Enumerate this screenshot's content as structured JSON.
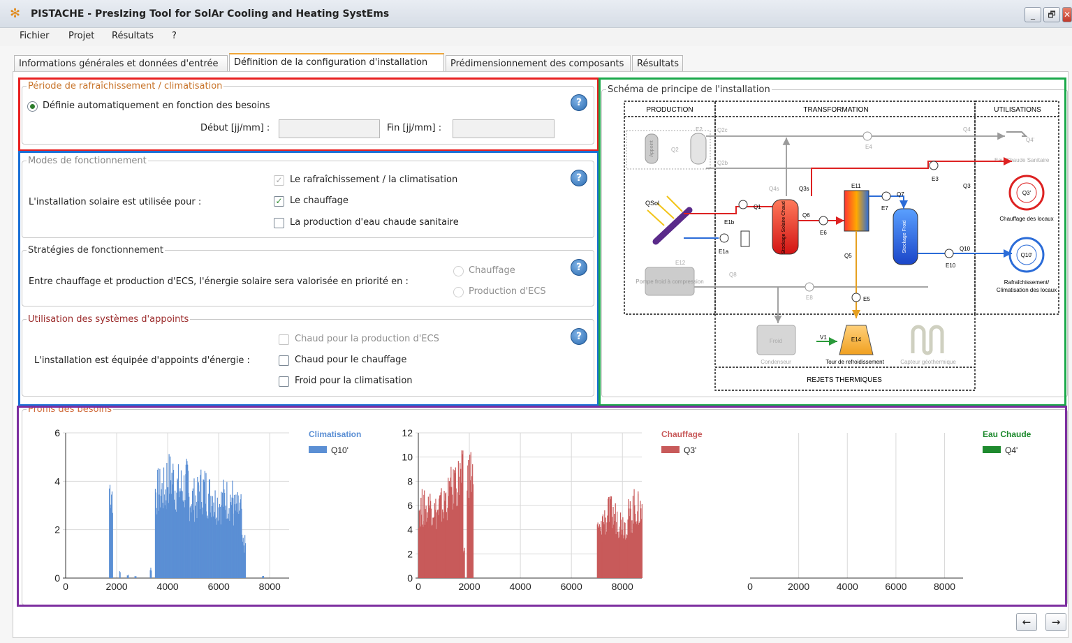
{
  "window": {
    "title": "PISTACHE - PresIzing Tool for SolAr Cooling and Heating SystEms",
    "minimize": "_",
    "restore": "🗗",
    "close": "✕"
  },
  "menu": [
    "Fichier",
    "Projet",
    "Résultats",
    "?"
  ],
  "tabs": [
    "Informations générales et données d'entrée",
    "Définition de la configuration d'installation",
    "Prédimensionnement des composants",
    "Résultats"
  ],
  "periode": {
    "legend": "Période de rafraîchissement / climatisation",
    "radio_label": "Définie automatiquement en fonction des besoins",
    "debut_label": "Début [jj/mm] :",
    "fin_label": "Fin [jj/mm] :",
    "debut_value": "",
    "fin_value": "",
    "help": "?"
  },
  "modes": {
    "legend": "Modes de fonctionnement",
    "question": "L'installation solaire est utilisée pour :",
    "options": [
      "Le rafraîchissement / la climatisation",
      "Le chauffage",
      "La production d'eau chaude sanitaire"
    ],
    "help": "?"
  },
  "strategies": {
    "legend": "Stratégies de fonctionnement",
    "question": "Entre chauffage et production d'ECS, l'énergie solaire sera valorisée en priorité en :",
    "options": [
      "Chauffage",
      "Production d'ECS"
    ],
    "help": "?"
  },
  "appoints": {
    "legend": "Utilisation des systèmes d'appoints",
    "question": "L'installation est équipée d'appoints d'énergie :",
    "options": [
      "Chaud pour la production d'ECS",
      "Chaud pour le chauffage",
      "Froid pour la climatisation"
    ],
    "help": "?"
  },
  "schema": {
    "legend": "Schéma de principe de l'installation",
    "production": "PRODUCTION",
    "transformation": "TRANSFORMATION",
    "utilisations": "UTILISATIONS",
    "rejets": "REJETS THERMIQUES",
    "labels": {
      "qsol": "QSol",
      "appoint": "Appoint",
      "q2": "Q2",
      "q2b": "Q2b",
      "q2c": "Q2c",
      "e2": "E2",
      "e4": "E4",
      "q4": "Q4",
      "q4p": "Q4'",
      "ecs": "Eau Chaude Sanitaire",
      "e3": "E3",
      "q3": "Q3",
      "q3s": "Q3s",
      "q4s": "Q4s",
      "e11": "E11",
      "q7": "Q7",
      "e7": "E7",
      "q1": "Q1",
      "e1b": "E1b",
      "e1a": "E1a",
      "q6": "Q6",
      "e6": "E6",
      "stock_chaud": "Stockage Solaire Chaud",
      "stock_froid": "Stockage Froid",
      "q5": "Q5",
      "e5": "E5",
      "q3p": "Q3'",
      "chauffage": "Chauffage des locaux",
      "q10": "Q10",
      "e10": "E10",
      "q10p": "Q10'",
      "rafr1": "Rafraîchissement/",
      "rafr2": "Climatisation des locaux",
      "e12": "E12",
      "pac": "Pompe froid à compression",
      "q8": "Q8",
      "e8": "E8",
      "v1": "V1",
      "e14": "E14",
      "condenseur": "Condenseur",
      "tour": "Tour de refroidissement",
      "geo": "Capteur géothermique",
      "cond_box": "Froid"
    }
  },
  "profils": {
    "legend": "Profils des besoins"
  },
  "chart_data": [
    {
      "type": "bar",
      "title": "Climatisation",
      "series": [
        {
          "name": "Q10'",
          "color": "#5b8fd4"
        }
      ],
      "xlim": [
        0,
        8760
      ],
      "ylim": [
        0,
        6
      ],
      "xticks": [
        0,
        2000,
        4000,
        6000,
        8000
      ],
      "yticks": [
        0,
        2,
        4,
        6
      ],
      "values_ranges": [
        [
          1700,
          1760,
          4.8
        ],
        [
          1760,
          1830,
          4.6
        ],
        [
          2100,
          2140,
          0.3
        ],
        [
          2400,
          2450,
          0.15
        ],
        [
          2700,
          2750,
          0.1
        ],
        [
          3300,
          3350,
          0.5
        ],
        [
          3500,
          3950,
          4.6
        ],
        [
          3950,
          4250,
          5.3
        ],
        [
          4250,
          4700,
          4.8
        ],
        [
          4700,
          4800,
          5.0
        ],
        [
          4800,
          5200,
          4.2
        ],
        [
          5200,
          5500,
          4.7
        ],
        [
          5500,
          5800,
          4.4
        ],
        [
          5800,
          6150,
          4.0
        ],
        [
          6150,
          6550,
          4.2
        ],
        [
          6550,
          6900,
          3.6
        ],
        [
          6900,
          7050,
          1.8
        ],
        [
          7700,
          7750,
          0.1
        ]
      ]
    },
    {
      "type": "bar",
      "title": "Chauffage",
      "series": [
        {
          "name": "Q3'",
          "color": "#c85a5a"
        }
      ],
      "xlim": [
        0,
        8760
      ],
      "ylim": [
        0,
        12
      ],
      "xticks": [
        0,
        2000,
        4000,
        6000,
        8000
      ],
      "yticks": [
        0,
        2,
        4,
        6,
        8,
        10,
        12
      ],
      "values_ranges": [
        [
          0,
          200,
          7.5
        ],
        [
          200,
          400,
          7.3
        ],
        [
          400,
          600,
          7.8
        ],
        [
          600,
          800,
          7.0
        ],
        [
          800,
          1000,
          7.6
        ],
        [
          1000,
          1200,
          8.5
        ],
        [
          1200,
          1400,
          9.2
        ],
        [
          1400,
          1600,
          10.2
        ],
        [
          1600,
          1750,
          10.6
        ],
        [
          1750,
          1800,
          3.0
        ],
        [
          1900,
          2000,
          10.9
        ],
        [
          2000,
          2150,
          11.1
        ],
        [
          7000,
          7200,
          5.0
        ],
        [
          7200,
          7400,
          6.2
        ],
        [
          7400,
          7600,
          6.8
        ],
        [
          7600,
          7800,
          6.5
        ],
        [
          7800,
          8000,
          6.0
        ],
        [
          8000,
          8200,
          5.8
        ],
        [
          8200,
          8400,
          6.6
        ],
        [
          8400,
          8600,
          7.5
        ],
        [
          8600,
          8760,
          7.2
        ]
      ]
    },
    {
      "type": "bar",
      "title": "Eau Chaude",
      "series": [
        {
          "name": "Q4'",
          "color": "#1e8a2e"
        }
      ],
      "xlim": [
        0,
        8760
      ],
      "xticks": [
        0,
        2000,
        4000,
        6000,
        8000
      ],
      "values_ranges": []
    }
  ],
  "nav": {
    "prev": "←",
    "next": "→"
  },
  "colors": {
    "highlight_red": "#e82020",
    "highlight_blue": "#1a6fd6",
    "highlight_green": "#1aa94a",
    "highlight_purple": "#7d2fa0",
    "legend_orange": "#c8742a",
    "legend_red": "#9b2a2a"
  }
}
